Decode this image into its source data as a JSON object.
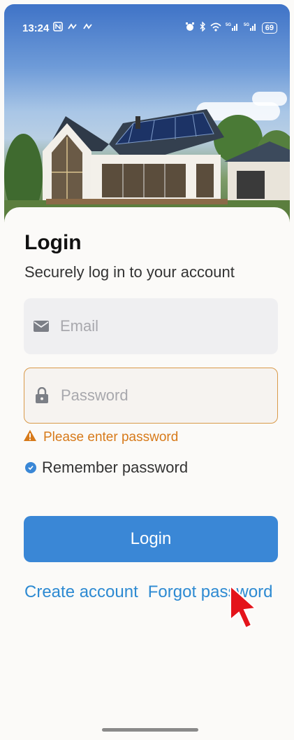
{
  "status_bar": {
    "time": "13:24",
    "left_icons": [
      "nfc-icon",
      "sync-icon",
      "sync-icon"
    ],
    "right_icons": [
      "alarm-icon",
      "bluetooth-icon",
      "wifi-icon",
      "signal-5g-icon",
      "signal-5g-icon"
    ],
    "battery": "69"
  },
  "hero": {
    "image": "house-with-solar-panels"
  },
  "form": {
    "title": "Login",
    "subtitle": "Securely log in to your account",
    "email": {
      "placeholder": "Email",
      "value": ""
    },
    "password": {
      "placeholder": "Password",
      "value": ""
    },
    "error": "Please enter password",
    "remember": {
      "label": "Remember password",
      "checked": true
    },
    "login_button": "Login",
    "create_account": "Create account",
    "forgot_password": "Forgot password"
  },
  "colors": {
    "accent": "#3a87d6",
    "link": "#2d8ad2",
    "error": "#d77a1a",
    "error_border": "#d99a4a"
  }
}
